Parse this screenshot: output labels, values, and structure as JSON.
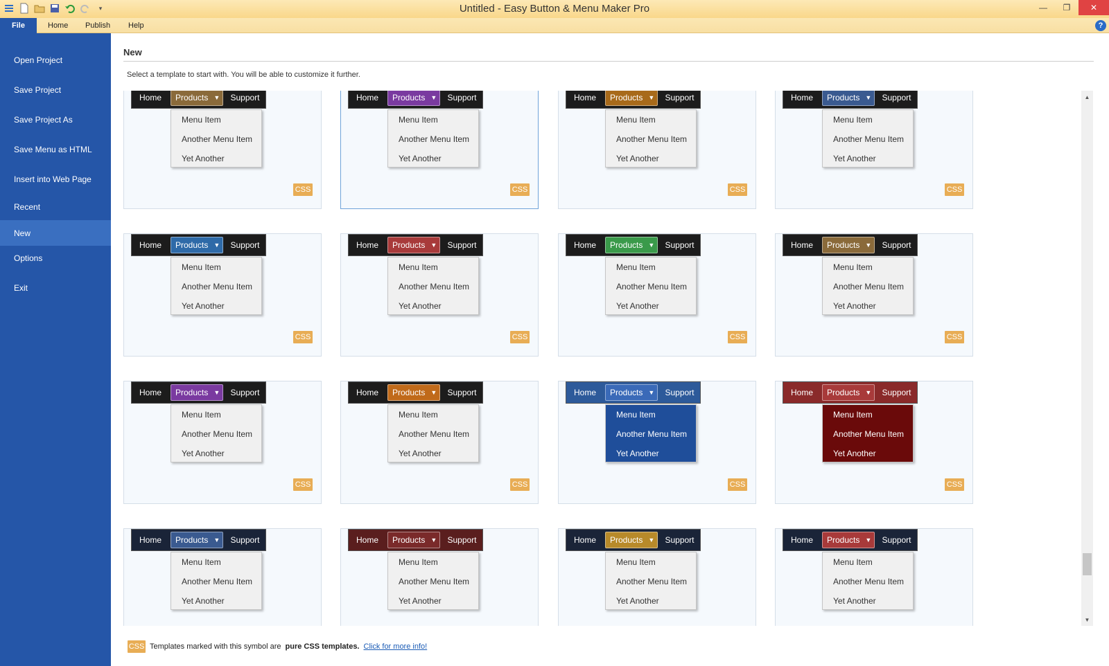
{
  "window": {
    "title": "Untitled - Easy Button & Menu Maker Pro"
  },
  "quick_access": [
    "menu-icon",
    "new-file-icon",
    "open-folder-icon",
    "save-icon",
    "undo-icon",
    "redo-icon",
    "customize-dropdown-icon"
  ],
  "ribbon": {
    "tabs": [
      "File",
      "Home",
      "Publish",
      "Help"
    ],
    "help_label": "?"
  },
  "sidebar": {
    "items": [
      "Open Project",
      "Save Project",
      "Save Project As",
      "Save Menu as HTML",
      "Insert into Web Page",
      "Recent",
      "New",
      "Options",
      "Exit"
    ],
    "active": "New"
  },
  "main": {
    "title": "New",
    "instructions": "Select a template to start with. You will be able to customize it further."
  },
  "template_text": {
    "home": "Home",
    "products": "Products",
    "support": "Support",
    "items": [
      "Menu Item",
      "Another Menu Item",
      "Yet Another"
    ],
    "badge": "CSS"
  },
  "templates": [
    {
      "bar": "#1c1c1c",
      "accent": "#8a6a3a",
      "dropdown": "#f0f0f0",
      "dtext": "#333333"
    },
    {
      "bar": "#1c1c1c",
      "accent": "#7a3aa0",
      "dropdown": "#f0f0f0",
      "dtext": "#333333"
    },
    {
      "bar": "#1c1c1c",
      "accent": "#a86a1a",
      "dropdown": "#f0f0f0",
      "dtext": "#333333"
    },
    {
      "bar": "#1c1c1c",
      "accent": "#3a5a90",
      "dropdown": "#f0f0f0",
      "dtext": "#333333"
    },
    {
      "bar": "#1c1c1c",
      "accent": "#2e6aa8",
      "dropdown": "#f0f0f0",
      "dtext": "#333333"
    },
    {
      "bar": "#1c1c1c",
      "accent": "#a83a3a",
      "dropdown": "#f0f0f0",
      "dtext": "#333333"
    },
    {
      "bar": "#1c1c1c",
      "accent": "#3a9a4a",
      "dropdown": "#f0f0f0",
      "dtext": "#333333"
    },
    {
      "bar": "#1c1c1c",
      "accent": "#8a6a3a",
      "dropdown": "#f0f0f0",
      "dtext": "#333333"
    },
    {
      "bar": "#1c1c1c",
      "accent": "#7a3aa0",
      "dropdown": "#f0f0f0",
      "dtext": "#333333"
    },
    {
      "bar": "#1c1c1c",
      "accent": "#c06a1a",
      "dropdown": "#f0f0f0",
      "dtext": "#333333"
    },
    {
      "bar": "#2d5a9a",
      "accent": "#3a6ab8",
      "dropdown": "#1f4e9a",
      "dtext": "#ffffff"
    },
    {
      "bar": "#8a2a2a",
      "accent": "#a83a3a",
      "dropdown": "#6a0a0a",
      "dtext": "#ffffff"
    },
    {
      "bar": "#1a2438",
      "accent": "#3a5a90",
      "dropdown": "#f0f0f0",
      "dtext": "#333333"
    },
    {
      "bar": "#5a1e1e",
      "accent": "#7a2a2a",
      "dropdown": "#f0f0f0",
      "dtext": "#333333"
    },
    {
      "bar": "#1a2438",
      "accent": "#b88a2a",
      "dropdown": "#f0f0f0",
      "dtext": "#333333"
    },
    {
      "bar": "#1a2438",
      "accent": "#a83a3a",
      "dropdown": "#f0f0f0",
      "dtext": "#333333"
    }
  ],
  "footer": {
    "badge": "CSS",
    "text": "Templates marked with this symbol are",
    "bold": "pure CSS templates.",
    "link": "Click for more info!"
  }
}
